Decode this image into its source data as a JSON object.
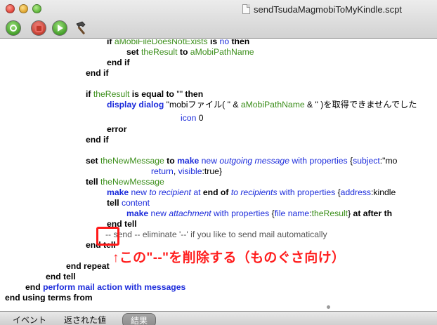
{
  "window": {
    "title": "sendTsudaMagmobiToMyKindle.scpt"
  },
  "toolbar": {
    "icons": [
      "record-icon",
      "stop-icon",
      "run-icon",
      "compile-hammer-icon"
    ]
  },
  "code": {
    "l01": {
      "a": "if ",
      "b": "aMobiFileDoesNotExists",
      "c": " is ",
      "d": "no",
      "e": " then"
    },
    "l02": {
      "a": "set ",
      "b": "theResult",
      "c": " to ",
      "d": "aMobiPathName"
    },
    "l03": "end if",
    "l04": "end if",
    "l05": {
      "a": "if ",
      "b": "theResult",
      "c": " is equal to ",
      "d": "\"\"",
      "e": " then"
    },
    "l06": {
      "a": "display dialog",
      "b": " \"mobiファイル( \" & ",
      "c": "aMobiPathName",
      "d": " & \" )を取得できませんでした"
    },
    "l07": {
      "a": "icon",
      "b": " 0"
    },
    "l08": "error",
    "l09": "end if",
    "l10": {
      "a": "set ",
      "b": "theNewMessage",
      "c": " to ",
      "d": "make",
      "e": " new ",
      "f": "outgoing message",
      "g": " with ",
      "h": "properties",
      "i": " {",
      "j": "subject",
      "k": ":\"mo"
    },
    "l11": {
      "a": "return",
      "b": ", ",
      "c": "visible",
      "d": ":true}"
    },
    "l12": {
      "a": "tell ",
      "b": "theNewMessage"
    },
    "l13": {
      "a": "make",
      "b": " new ",
      "c": "to recipient",
      "d": " at ",
      "e": "end of",
      "f": " ",
      "g": "to recipients",
      "h": " with ",
      "i": "properties",
      "j": " {",
      "k": "address",
      "l": ":kindle"
    },
    "l14": {
      "a": "tell ",
      "b": "content"
    },
    "l15": {
      "a": "make",
      "b": " new ",
      "c": "attachment",
      "d": " with ",
      "e": "properties",
      "f": " {",
      "g": "file name",
      "h": ":",
      "i": "theResult",
      "j": "} ",
      "k": "at",
      "l": " after th"
    },
    "l16": "end tell",
    "l17": "-- send    -- eliminate '--' if you like to send mail automatically",
    "l18": "end tell",
    "l19": "end repeat",
    "l20": "end tell",
    "l21": {
      "a": "end ",
      "b": "perform mail action with messages"
    },
    "l22": "end using terms from"
  },
  "annotation": {
    "text": "↑この\"--\"を削除する（ものぐさ向け）"
  },
  "bottom_tabs": {
    "events": "イベント",
    "returned": "返された値",
    "result": "結果"
  }
}
